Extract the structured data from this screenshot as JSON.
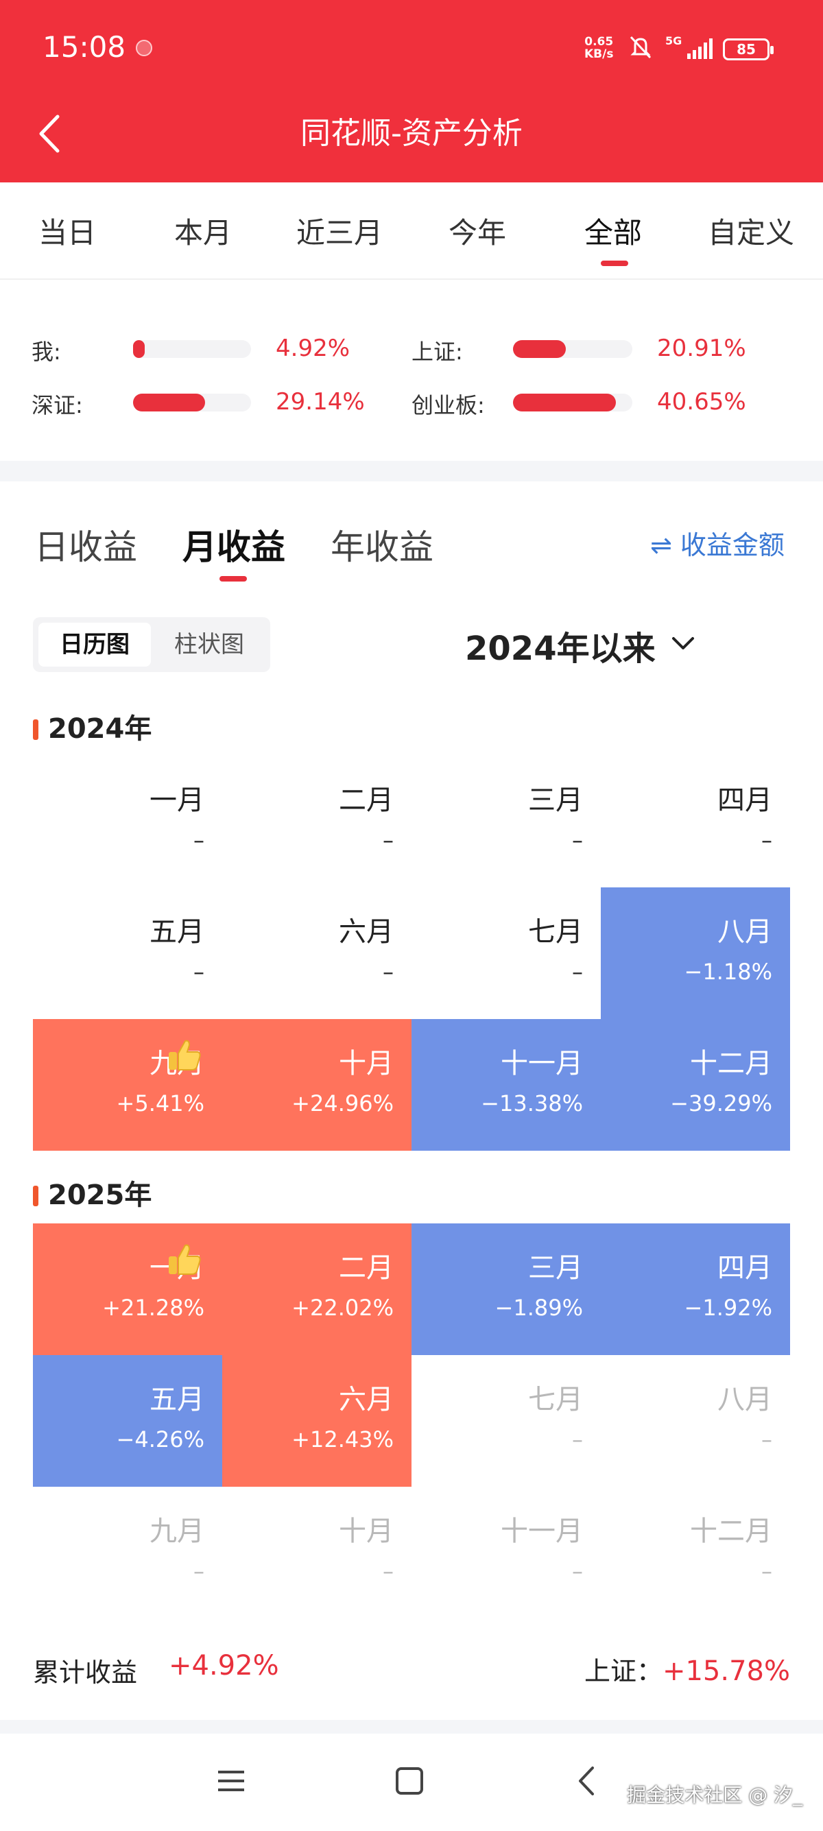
{
  "status": {
    "time": "15:08",
    "net_speed_value": "0.65",
    "net_speed_unit": "KB/s",
    "network": "5G",
    "battery": "85"
  },
  "header": {
    "title": "同花顺-资产分析"
  },
  "period_tabs": [
    "当日",
    "本月",
    "近三月",
    "今年",
    "全部",
    "自定义"
  ],
  "period_active": "全部",
  "comparison": [
    {
      "label": "我:",
      "value": "4.92%",
      "fill": 0.1
    },
    {
      "label": "上证:",
      "value": "20.91%",
      "fill": 0.44
    },
    {
      "label": "深证:",
      "value": "29.14%",
      "fill": 0.61
    },
    {
      "label": "创业板:",
      "value": "40.65%",
      "fill": 0.86
    }
  ],
  "return_tabs": [
    "日收益",
    "月收益",
    "年收益"
  ],
  "return_active": "月收益",
  "amount_toggle": "⇌ 收益金额",
  "view_toggle": {
    "calendar": "日历图",
    "bar": "柱状图",
    "active": "日历图"
  },
  "range_select": "2024年以来",
  "years": [
    {
      "title": "2024年",
      "months": [
        {
          "m": "一月",
          "v": "–",
          "kind": "none"
        },
        {
          "m": "二月",
          "v": "–",
          "kind": "none"
        },
        {
          "m": "三月",
          "v": "–",
          "kind": "none"
        },
        {
          "m": "四月",
          "v": "–",
          "kind": "none"
        },
        {
          "m": "五月",
          "v": "–",
          "kind": "none"
        },
        {
          "m": "六月",
          "v": "–",
          "kind": "none"
        },
        {
          "m": "七月",
          "v": "–",
          "kind": "none"
        },
        {
          "m": "八月",
          "v": "−1.18%",
          "kind": "neg"
        },
        {
          "m": "九月",
          "v": "+5.41%",
          "kind": "pos"
        },
        {
          "m": "十月",
          "v": "+24.96%",
          "kind": "pos",
          "best": true
        },
        {
          "m": "十一月",
          "v": "−13.38%",
          "kind": "neg"
        },
        {
          "m": "十二月",
          "v": "−39.29%",
          "kind": "neg"
        }
      ]
    },
    {
      "title": "2025年",
      "months": [
        {
          "m": "一月",
          "v": "+21.28%",
          "kind": "pos"
        },
        {
          "m": "二月",
          "v": "+22.02%",
          "kind": "pos",
          "best": true
        },
        {
          "m": "三月",
          "v": "−1.89%",
          "kind": "neg"
        },
        {
          "m": "四月",
          "v": "−1.92%",
          "kind": "neg"
        },
        {
          "m": "五月",
          "v": "−4.26%",
          "kind": "neg"
        },
        {
          "m": "六月",
          "v": "+12.43%",
          "kind": "pos"
        },
        {
          "m": "七月",
          "v": "–",
          "kind": "future"
        },
        {
          "m": "八月",
          "v": "–",
          "kind": "future"
        },
        {
          "m": "九月",
          "v": "–",
          "kind": "future"
        },
        {
          "m": "十月",
          "v": "–",
          "kind": "future"
        },
        {
          "m": "十一月",
          "v": "–",
          "kind": "future"
        },
        {
          "m": "十二月",
          "v": "–",
          "kind": "future"
        }
      ]
    }
  ],
  "summary": {
    "label": "累计收益",
    "value": "+4.92%",
    "bench_label": "上证：",
    "bench_value": "+15.78%"
  },
  "watermark": "掘金技术社区 @ 汐_",
  "colors": {
    "brand_red": "#f0303c",
    "positive": "#ff735c",
    "negative": "#7092e6",
    "link_blue": "#3a78d4"
  }
}
